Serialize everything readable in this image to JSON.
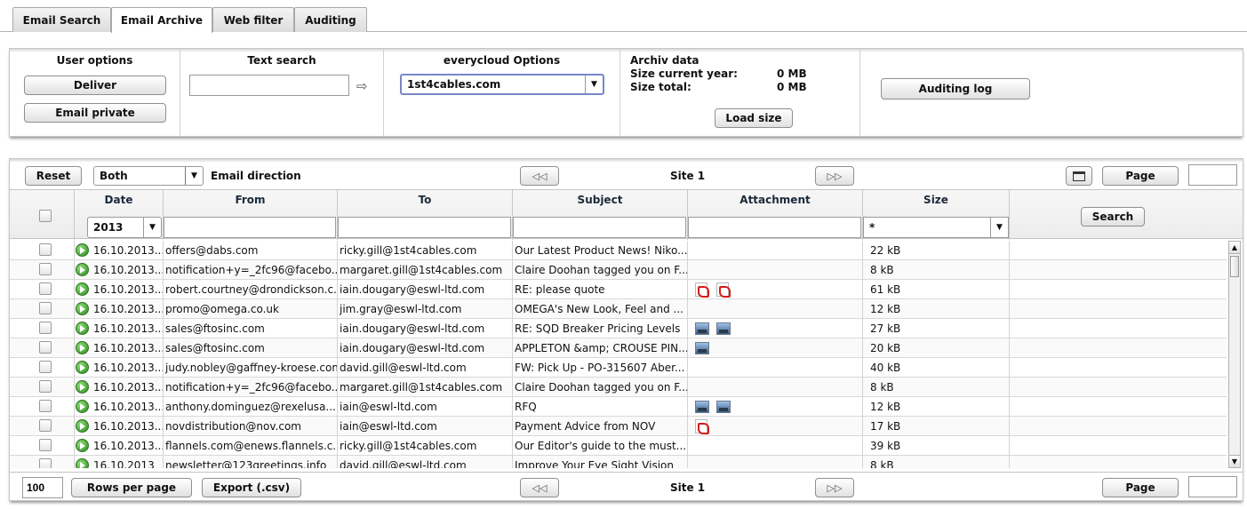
{
  "tabs": [
    {
      "label": "Email Search"
    },
    {
      "label": "Email Archive"
    },
    {
      "label": "Web filter"
    },
    {
      "label": "Auditing"
    }
  ],
  "user_options": {
    "title": "User options",
    "deliver": "Deliver",
    "email_private": "Email private"
  },
  "text_search": {
    "title": "Text search",
    "value": "",
    "arrow": "⇨"
  },
  "everycloud": {
    "title": "everycloud Options",
    "selected": "1st4cables.com"
  },
  "archiv": {
    "title": "Archiv data",
    "size_current_year_label": "Size current year:",
    "size_current_year_value": "0 MB",
    "size_total_label": "Size total:",
    "size_total_value": "0 MB",
    "load_size": "Load size"
  },
  "auditing_log": "Auditing log",
  "toolbar": {
    "reset": "Reset",
    "direction_selected": "Both",
    "direction_label": "Email direction",
    "site_label": "Site 1",
    "page_button": "Page",
    "page_value": ""
  },
  "columns": {
    "date": "Date",
    "from": "From",
    "to": "To",
    "subject": "Subject",
    "attachment": "Attachment",
    "size": "Size",
    "year_selected": "2013",
    "size_filter": "*",
    "search": "Search"
  },
  "rows": [
    {
      "date": "16.10.2013...",
      "from": "offers@dabs.com",
      "to": "ricky.gill@1st4cables.com",
      "subject": "Our Latest Product News! Niko...",
      "attachments": [],
      "size": "22 kB"
    },
    {
      "date": "16.10.2013...",
      "from": "notification+y=_2fc96@facebo...",
      "to": "margaret.gill@1st4cables.com",
      "subject": "Claire Doohan tagged you on F...",
      "attachments": [],
      "size": "8 kB"
    },
    {
      "date": "16.10.2013...",
      "from": "robert.courtney@drondickson.c...",
      "to": "iain.dougary@eswl-ltd.com",
      "subject": "RE: please quote",
      "attachments": [
        "pdf",
        "pdf"
      ],
      "size": "61 kB"
    },
    {
      "date": "16.10.2013...",
      "from": "promo@omega.co.uk",
      "to": "jim.gray@eswl-ltd.com",
      "subject": "OMEGA's New Look, Feel and ...",
      "attachments": [],
      "size": "12 kB"
    },
    {
      "date": "16.10.2013...",
      "from": "sales@ftosinc.com",
      "to": "iain.dougary@eswl-ltd.com",
      "subject": "RE: SQD Breaker Pricing Levels",
      "attachments": [
        "image",
        "image"
      ],
      "size": "27 kB"
    },
    {
      "date": "16.10.2013...",
      "from": "sales@ftosinc.com",
      "to": "iain.dougary@eswl-ltd.com",
      "subject": "APPLETON &amp; CROUSE PIN...",
      "attachments": [
        "image"
      ],
      "size": "20 kB"
    },
    {
      "date": "16.10.2013...",
      "from": "judy.nobley@gaffney-kroese.com",
      "to": "david.gill@eswl-ltd.com",
      "subject": "FW: Pick Up - PO-315607 Aber...",
      "attachments": [],
      "size": "40 kB"
    },
    {
      "date": "16.10.2013...",
      "from": "notification+y=_2fc96@facebo...",
      "to": "margaret.gill@1st4cables.com",
      "subject": "Claire Doohan tagged you on F...",
      "attachments": [],
      "size": "8 kB"
    },
    {
      "date": "16.10.2013...",
      "from": "anthony.dominguez@rexelusa....",
      "to": "iain@eswl-ltd.com",
      "subject": "RFQ",
      "attachments": [
        "image",
        "image"
      ],
      "size": "12 kB"
    },
    {
      "date": "16.10.2013...",
      "from": "novdistribution@nov.com",
      "to": "iain@eswl-ltd.com",
      "subject": "Payment Advice from NOV",
      "attachments": [
        "pdf"
      ],
      "size": "17 kB"
    },
    {
      "date": "16.10.2013...",
      "from": "flannels.com@enews.flannels.c...",
      "to": "ricky.gill@1st4cables.com",
      "subject": "Our Editor's guide to the must...",
      "attachments": [],
      "size": "39 kB"
    },
    {
      "date": "16.10.2013",
      "from": "newsletter@123greetings.info",
      "to": "david.gill@eswl-ltd.com",
      "subject": "Improve Your Eye Sight Vision",
      "attachments": [],
      "size": "8 kB"
    }
  ],
  "footer": {
    "rows_value": "100",
    "rows_per_page": "Rows per page",
    "export": "Export (.csv)",
    "site_label": "Site 1",
    "page_button": "Page",
    "page_value": ""
  },
  "icons": {
    "row_status": "green-arrow-icon",
    "pdf": "pdf-icon",
    "image": "image-icon",
    "nav_prev": "rewind-icon",
    "nav_next": "fast-forward-icon",
    "column_toggle": "window-icon"
  }
}
